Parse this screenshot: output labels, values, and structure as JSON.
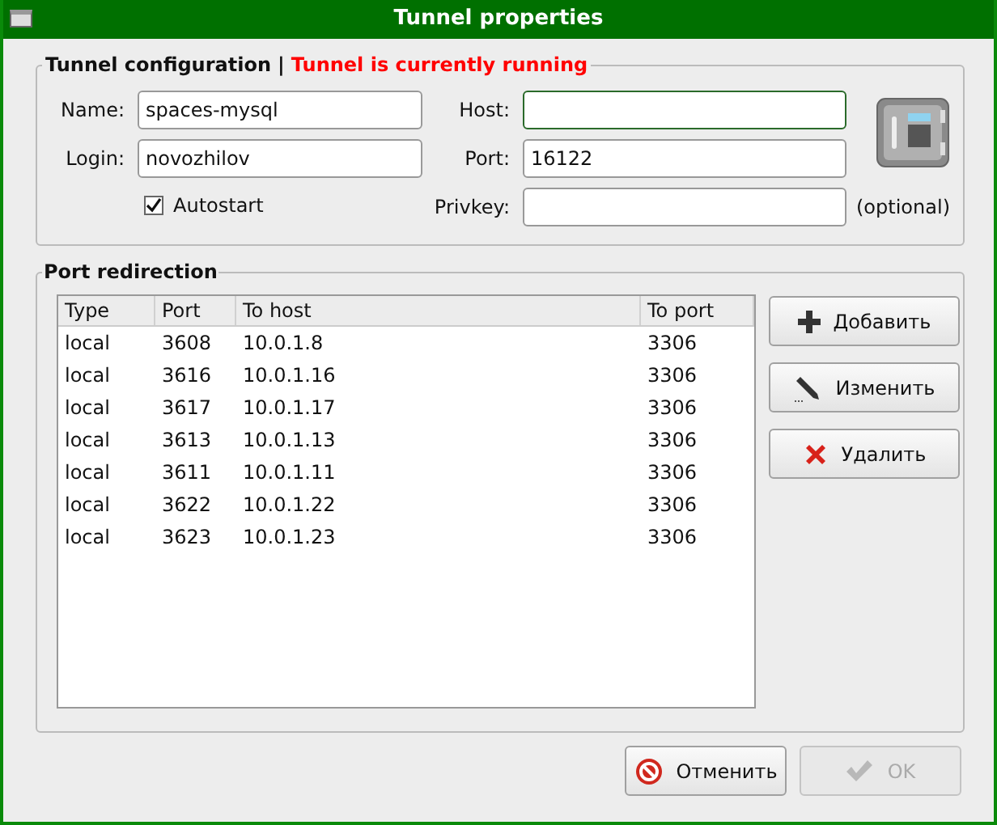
{
  "window": {
    "title": "Tunnel properties"
  },
  "tunnel_configuration": {
    "title": "Tunnel configuration",
    "separator": "|",
    "status": "Tunnel is currently running",
    "fields": [
      {
        "label": "Name:",
        "value": "spaces-mysql",
        "focused": false
      },
      {
        "label": "Login:",
        "value": "novozhilov",
        "focused": false
      },
      {
        "label": "Host:",
        "focused": true
      },
      {
        "label": "Port:",
        "value": "16122",
        "focused": false
      },
      {
        "label": "Privkey:",
        "focused": false,
        "note": "(optional)"
      }
    ],
    "autostart": {
      "label": "Autostart",
      "checked": true
    }
  },
  "port_redirection": {
    "title": "Port redirection",
    "table": {
      "columns": [
        "Type",
        "Port",
        "To host",
        "To port"
      ],
      "rows": [
        [
          "local",
          "3608",
          "10.0.1.8",
          "3306"
        ],
        [
          "local",
          "3616",
          "10.0.1.16",
          "3306"
        ],
        [
          "local",
          "3617",
          "10.0.1.17",
          "3306"
        ],
        [
          "local",
          "3613",
          "10.0.1.13",
          "3306"
        ],
        [
          "local",
          "3611",
          "10.0.1.11",
          "3306"
        ],
        [
          "local",
          "3622",
          "10.0.1.22",
          "3306"
        ],
        [
          "local",
          "3623",
          "10.0.1.23",
          "3306"
        ]
      ]
    },
    "buttons": [
      {
        "label": "Добавить",
        "kind": "add",
        "disabled": false
      },
      {
        "label": "Изменить",
        "kind": "edit",
        "disabled": false
      },
      {
        "label": "Удалить",
        "kind": "delete",
        "disabled": false
      }
    ]
  },
  "dialog_buttons": [
    {
      "label": "Отменить",
      "kind": "cancel",
      "disabled": false
    },
    {
      "label": "OK",
      "kind": "ok",
      "disabled": true
    }
  ]
}
